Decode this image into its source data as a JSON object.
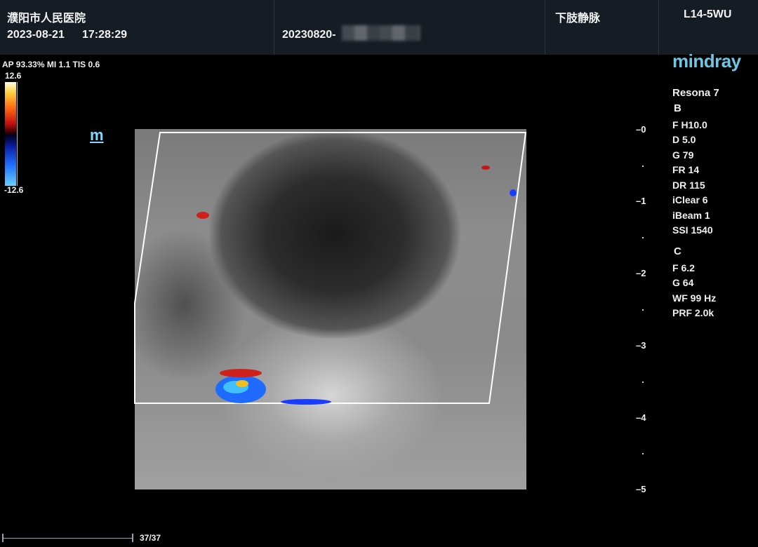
{
  "header": {
    "hospital": "濮阳市人民医院",
    "date": "2023-08-21",
    "time": "17:28:29",
    "patient_id": "20230820-",
    "exam": "下肢静脉",
    "probe": "L14-5WU"
  },
  "acoustic": {
    "info": "AP 93.33%  MI 1.1 TIS 0.6"
  },
  "color_scale": {
    "max": "12.6",
    "min": "-12.6"
  },
  "brand": "mindray",
  "device": "Resona 7",
  "b_mode": {
    "label": "B",
    "params": [
      "F H10.0",
      "D 5.0",
      "G 79",
      "FR 14",
      "DR 115",
      "iClear 6",
      "iBeam 1",
      "SSI 1540"
    ]
  },
  "c_mode": {
    "label": "C",
    "params": [
      "F 6.2",
      "G 64",
      "WF 99 Hz",
      "PRF 2.0k"
    ]
  },
  "depth_scale": [
    "0",
    "1",
    "2",
    "3",
    "4",
    "5"
  ],
  "cine": {
    "frame": "37/37",
    "progress": 1.0
  },
  "colors": {
    "header_bg": "#151c23",
    "brand": "#6cc6e4",
    "doppler_red": "#d0201a",
    "doppler_blue": "#1f6bff"
  }
}
